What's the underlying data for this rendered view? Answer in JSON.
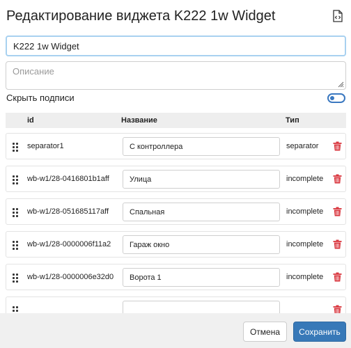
{
  "dialog": {
    "title": "Редактирование виджета K222 1w Widget",
    "name_value": "K222 1w Widget",
    "description_placeholder": "Описание",
    "hide_labels_text": "Скрыть подписи",
    "hide_labels_on": false
  },
  "table": {
    "headers": {
      "id": "id",
      "name": "Название",
      "type": "Тип"
    },
    "rows": [
      {
        "id": "separator1",
        "name": "С контроллера",
        "type": "separator"
      },
      {
        "id": "wb-w1/28-0416801b1aff",
        "name": "Улица",
        "type": "incomplete"
      },
      {
        "id": "wb-w1/28-051685117aff",
        "name": "Спальная",
        "type": "incomplete"
      },
      {
        "id": "wb-w1/28-0000006f11a2",
        "name": "Гараж окно",
        "type": "incomplete"
      },
      {
        "id": "wb-w1/28-0000006e32d0",
        "name": "Ворота 1",
        "type": "incomplete"
      },
      {
        "id": "",
        "name": "",
        "type": ""
      }
    ]
  },
  "footer": {
    "cancel_label": "Отмена",
    "save_label": "Сохранить"
  },
  "icons": {
    "code": "code-file-icon",
    "drag": "drag-handle-icon",
    "delete": "trash-icon"
  },
  "colors": {
    "accent": "#3879b8",
    "danger": "#d9363e",
    "toggle": "#3a78c0"
  }
}
